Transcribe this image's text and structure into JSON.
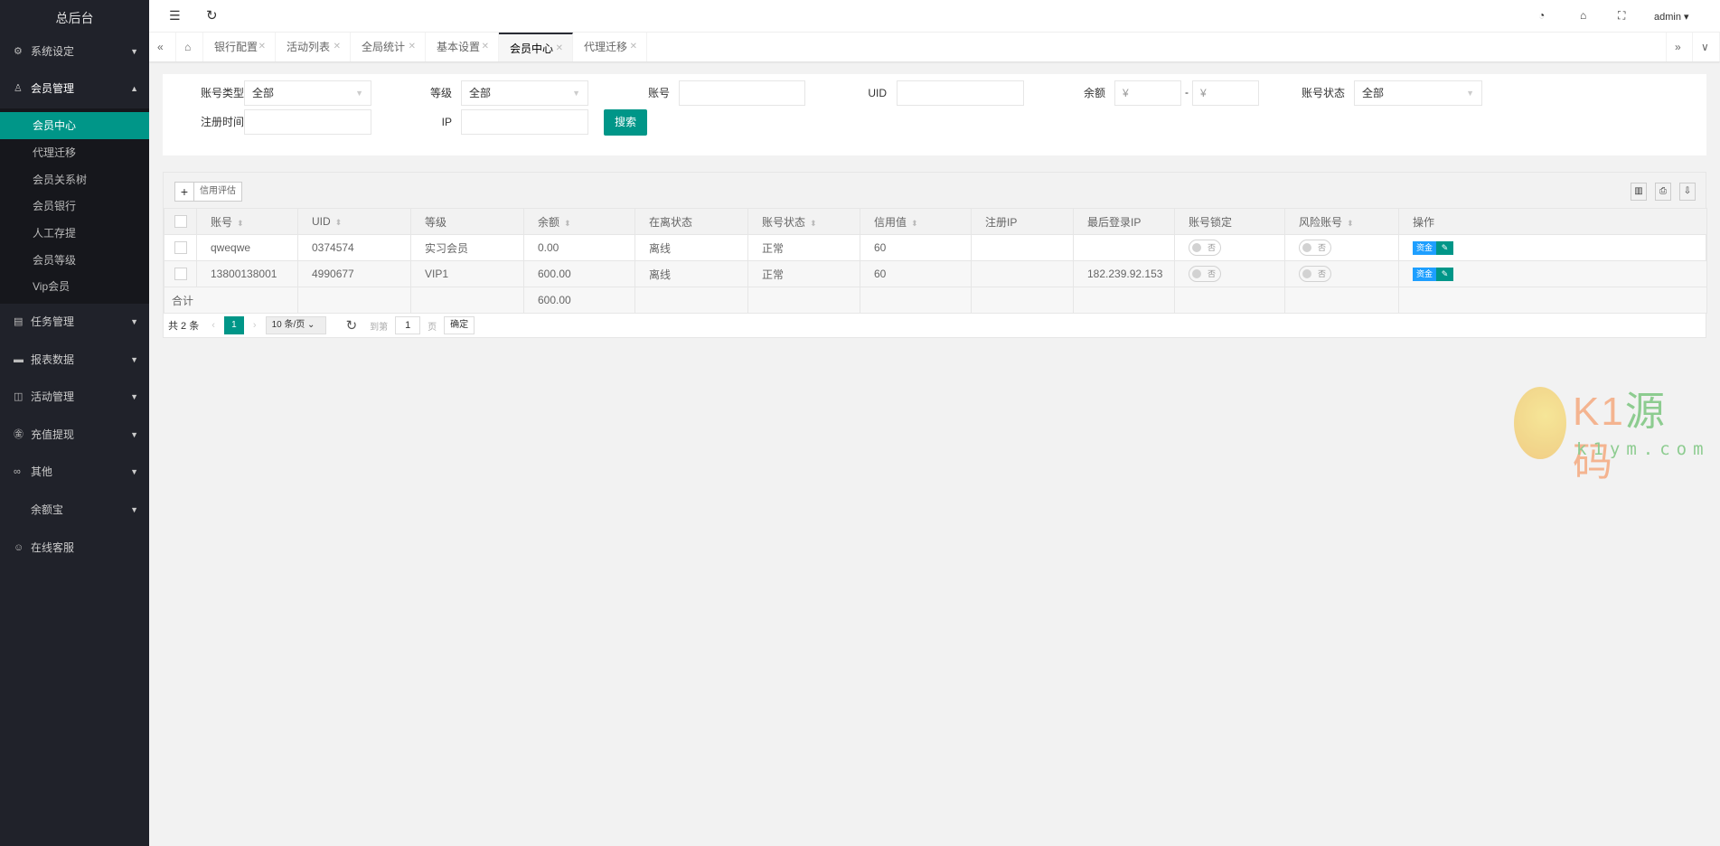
{
  "sidebar": {
    "title": "总后台",
    "menus": [
      {
        "label": "系统设定",
        "icon": "gear-icon"
      },
      {
        "label": "会员管理",
        "icon": "user-icon"
      },
      {
        "label": "任务管理",
        "icon": "task-icon"
      },
      {
        "label": "报表数据",
        "icon": "monitor-icon"
      },
      {
        "label": "活动管理",
        "icon": "book-icon"
      },
      {
        "label": "充值提现",
        "icon": "yen-icon"
      },
      {
        "label": "其他",
        "icon": "link-icon"
      },
      {
        "label": "余额宝",
        "icon": ""
      },
      {
        "label": "在线客服",
        "icon": "service-icon"
      }
    ],
    "submenu": [
      "会员中心",
      "代理迁移",
      "会员关系树",
      "会员银行",
      "人工存提",
      "会员等级",
      "Vip会员"
    ]
  },
  "header": {
    "user": "admin"
  },
  "tabs": [
    "银行配置",
    "活动列表",
    "全局统计",
    "基本设置",
    "会员中心",
    "代理迁移"
  ],
  "filters": {
    "account_type_label": "账号类型",
    "account_type_value": "全部",
    "level_label": "等级",
    "level_value": "全部",
    "account_label": "账号",
    "uid_label": "UID",
    "balance_label": "余额",
    "yen": "¥",
    "dash": "-",
    "status_label": "账号状态",
    "status_value": "全部",
    "reg_time_label": "注册时间",
    "ip_label": "IP",
    "search_button": "搜索"
  },
  "toolbar": {
    "add": "+",
    "credit": "信用评估"
  },
  "table": {
    "headers": [
      "账号",
      "UID",
      "等级",
      "余额",
      "在离状态",
      "账号状态",
      "信用值",
      "注册IP",
      "最后登录IP",
      "账号锁定",
      "风险账号",
      "操作"
    ],
    "rows": [
      [
        "qweqwe",
        "0374574",
        "实习会员",
        "0.00",
        "离线",
        "正常",
        "60",
        "",
        "",
        "否",
        "否"
      ],
      [
        "13800138001",
        "4990677",
        "VIP1",
        "600.00",
        "离线",
        "正常",
        "60",
        "",
        "182.239.92.153",
        "否",
        "否"
      ]
    ],
    "total_label": "合计",
    "total_balance": "600.00",
    "op_fund": "资金",
    "op_edit": "✎"
  },
  "pagination": {
    "total": "共 2 条",
    "page": "1",
    "per_page": "10 条/页",
    "goto": "到第",
    "goto_value": "1",
    "page_unit": "页",
    "confirm": "确定"
  },
  "watermark": {
    "brand": "K1源码",
    "url": "k1ym.com"
  }
}
